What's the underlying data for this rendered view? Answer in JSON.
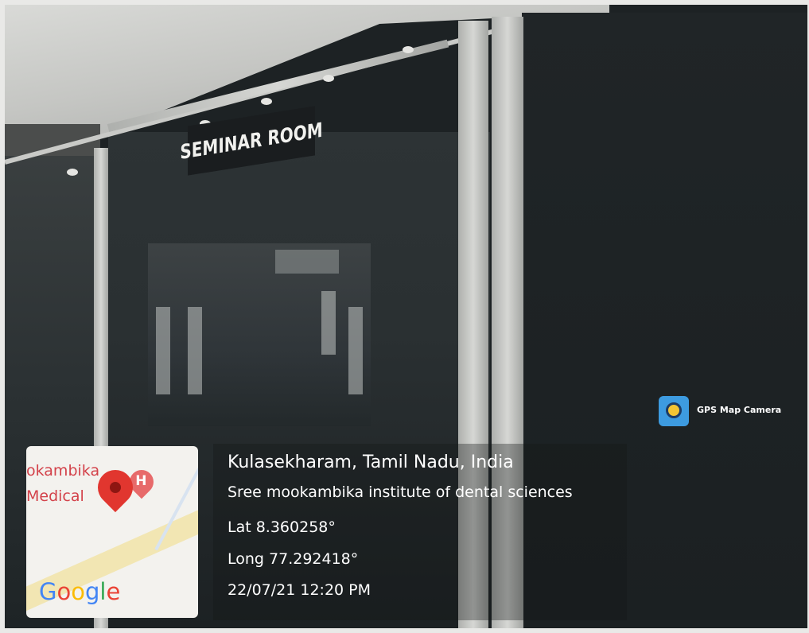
{
  "sign": {
    "text": "SEMINAR ROOM"
  },
  "map": {
    "label_line1": "okambika",
    "label_line2": "Medical",
    "hospital_marker": "H",
    "brand": [
      "G",
      "o",
      "o",
      "g",
      "l",
      "e"
    ],
    "pin_icon": "map-pin-icon"
  },
  "location": {
    "place": "Kulasekharam, Tamil Nadu, India",
    "institution": "Sree mookambika institute of dental sciences",
    "lat": "Lat 8.360258°",
    "long": "Long 77.292418°",
    "timestamp": "22/07/21 12:20 PM"
  },
  "badge": {
    "app_name": "GPS Map Camera",
    "icon": "gps-map-camera-icon"
  },
  "colors": {
    "pin": "#e1362f",
    "badge": "#3d9be0",
    "map_label": "#d3424a"
  }
}
